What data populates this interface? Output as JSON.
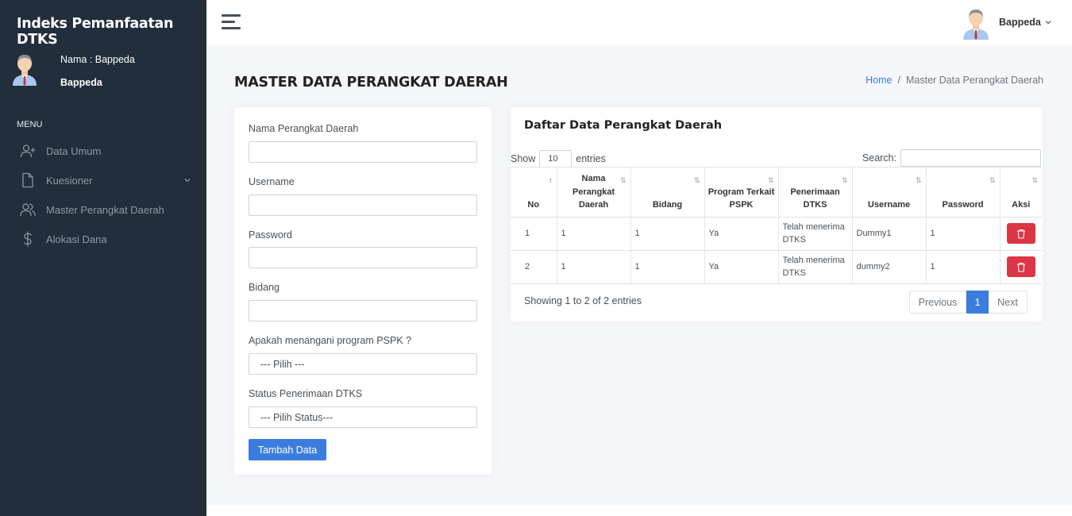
{
  "app": {
    "brand": "Indeks Pemanfaatan DTKS"
  },
  "sidebar": {
    "user_name_line": "Nama : Bappeda",
    "user_role": "Bappeda",
    "menu_header": "MENU",
    "items": [
      {
        "label": "Data Umum",
        "icon": "user-plus-icon"
      },
      {
        "label": "Kuesioner",
        "icon": "file-icon"
      },
      {
        "label": "Master Perangkat Daerah",
        "icon": "users-icon"
      },
      {
        "label": "Alokasi Dana",
        "icon": "dollar-icon"
      }
    ]
  },
  "topbar": {
    "user": "Bappeda"
  },
  "page": {
    "title": "MASTER DATA PERANGKAT DAERAH",
    "breadcrumb": {
      "home": "Home",
      "sep": "/",
      "current": "Master Data Perangkat Daerah"
    }
  },
  "form": {
    "nama_label": "Nama Perangkat Daerah",
    "nama_value": "",
    "username_label": "Username",
    "username_value": "",
    "password_label": "Password",
    "password_value": "",
    "bidang_label": "Bidang",
    "bidang_value": "",
    "pspk_label": "Apakah menangani program PSPK ?",
    "pspk_selected": "--- Pilih ---",
    "status_label": "Status Penerimaan DTKS",
    "status_selected": "--- Pilih Status---",
    "submit_label": "Tambah Data"
  },
  "table": {
    "title": "Daftar Data Perangkat Daerah",
    "show_label": "Show",
    "length_value": "10",
    "entries_label": "entries",
    "search_label": "Search:",
    "search_value": "",
    "columns": [
      "No",
      "Nama Perangkat Daerah",
      "Bidang",
      "Program Terkait PSPK",
      "Penerimaan DTKS",
      "Username",
      "Password",
      "Aksi"
    ],
    "rows": [
      {
        "no": "1",
        "nama": "1",
        "bidang": "1",
        "pspk": "Ya",
        "dtks": "Telah menerima DTKS",
        "username": "Dummy1",
        "password": "1"
      },
      {
        "no": "2",
        "nama": "1",
        "bidang": "1",
        "pspk": "Ya",
        "dtks": "Telah menerima DTKS",
        "username": "dummy2",
        "password": "1"
      }
    ],
    "info": "Showing 1 to 2 of 2 entries",
    "paging": {
      "prev": "Previous",
      "current": "1",
      "next": "Next"
    }
  },
  "colors": {
    "sidebar_bg": "#222e3c",
    "primary": "#3b7ddd",
    "danger": "#dc3545",
    "content_bg": "#f5f7fb"
  }
}
